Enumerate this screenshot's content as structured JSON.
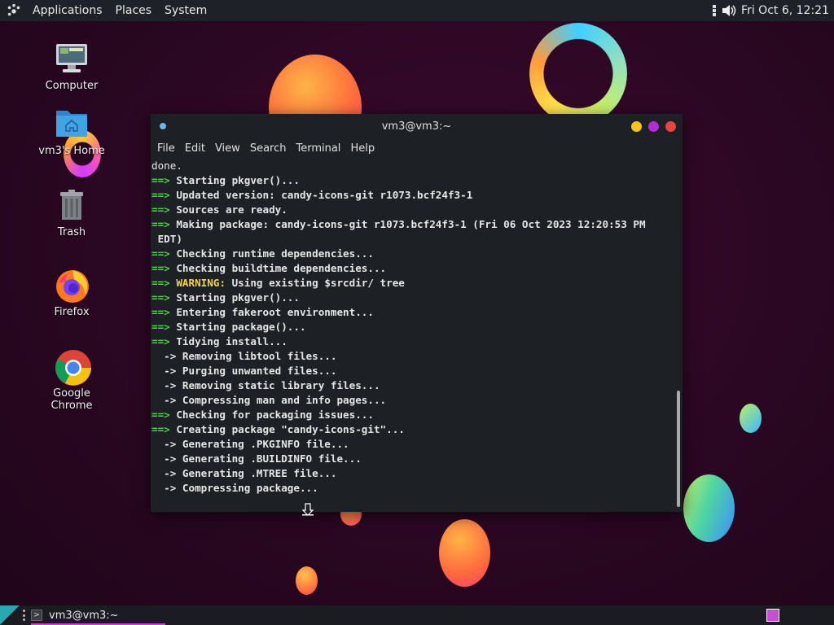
{
  "top_panel": {
    "menus": [
      "Applications",
      "Places",
      "System"
    ],
    "clock": "Fri Oct 6, 12:21",
    "icons": [
      "vertical-dots-icon",
      "volume-icon"
    ]
  },
  "desktop": {
    "icons": [
      {
        "label": "Computer",
        "icon": "computer-icon"
      },
      {
        "label": "vm3's Home",
        "icon": "home-folder-icon"
      },
      {
        "label": "Trash",
        "icon": "trash-icon"
      },
      {
        "label": "Firefox",
        "icon": "firefox-icon"
      },
      {
        "label": "Google Chrome",
        "icon": "chrome-icon"
      }
    ]
  },
  "terminal": {
    "title": "vm3@vm3:~",
    "menu": [
      "File",
      "Edit",
      "View",
      "Search",
      "Terminal",
      "Help"
    ],
    "lines": [
      {
        "prefix": "",
        "text": "done.",
        "bold": false
      },
      {
        "prefix": "==>",
        "text": " Starting pkgver()...",
        "bold": true
      },
      {
        "prefix": "==>",
        "text": " Updated version: candy-icons-git r1073.bcf24f3-1",
        "bold": true
      },
      {
        "prefix": "==>",
        "text": " Sources are ready.",
        "bold": true
      },
      {
        "prefix": "==>",
        "text": " Making package: candy-icons-git r1073.bcf24f3-1 (Fri 06 Oct 2023 12:20:53 PM",
        "bold": true
      },
      {
        "prefix": "",
        "text": " EDT)",
        "bold": true
      },
      {
        "prefix": "==>",
        "text": " Checking runtime dependencies...",
        "bold": true
      },
      {
        "prefix": "==>",
        "text": " Checking buildtime dependencies...",
        "bold": true
      },
      {
        "prefix": "==>",
        "warn": " WARNING:",
        "text": " Using existing $srcdir/ tree",
        "bold": true
      },
      {
        "prefix": "==>",
        "text": " Starting pkgver()...",
        "bold": true
      },
      {
        "prefix": "==>",
        "text": " Entering fakeroot environment...",
        "bold": true
      },
      {
        "prefix": "==>",
        "text": " Starting package()...",
        "bold": true
      },
      {
        "prefix": "==>",
        "text": " Tidying install...",
        "bold": true
      },
      {
        "prefix": "",
        "text": "  -> Removing libtool files...",
        "bold": true
      },
      {
        "prefix": "",
        "text": "  -> Purging unwanted files...",
        "bold": true
      },
      {
        "prefix": "",
        "text": "  -> Removing static library files...",
        "bold": true
      },
      {
        "prefix": "",
        "text": "  -> Compressing man and info pages...",
        "bold": true
      },
      {
        "prefix": "==>",
        "text": " Checking for packaging issues...",
        "bold": true
      },
      {
        "prefix": "==>",
        "text": " Creating package \"candy-icons-git\"...",
        "bold": true
      },
      {
        "prefix": "",
        "text": "  -> Generating .PKGINFO file...",
        "bold": true
      },
      {
        "prefix": "",
        "text": "  -> Generating .BUILDINFO file...",
        "bold": true
      },
      {
        "prefix": "",
        "text": "  -> Generating .MTREE file...",
        "bold": true
      },
      {
        "prefix": "",
        "text": "  -> Compressing package...",
        "bold": true
      }
    ]
  },
  "bottom_panel": {
    "task_label": "vm3@vm3:~",
    "accent": "#d43ad8"
  }
}
